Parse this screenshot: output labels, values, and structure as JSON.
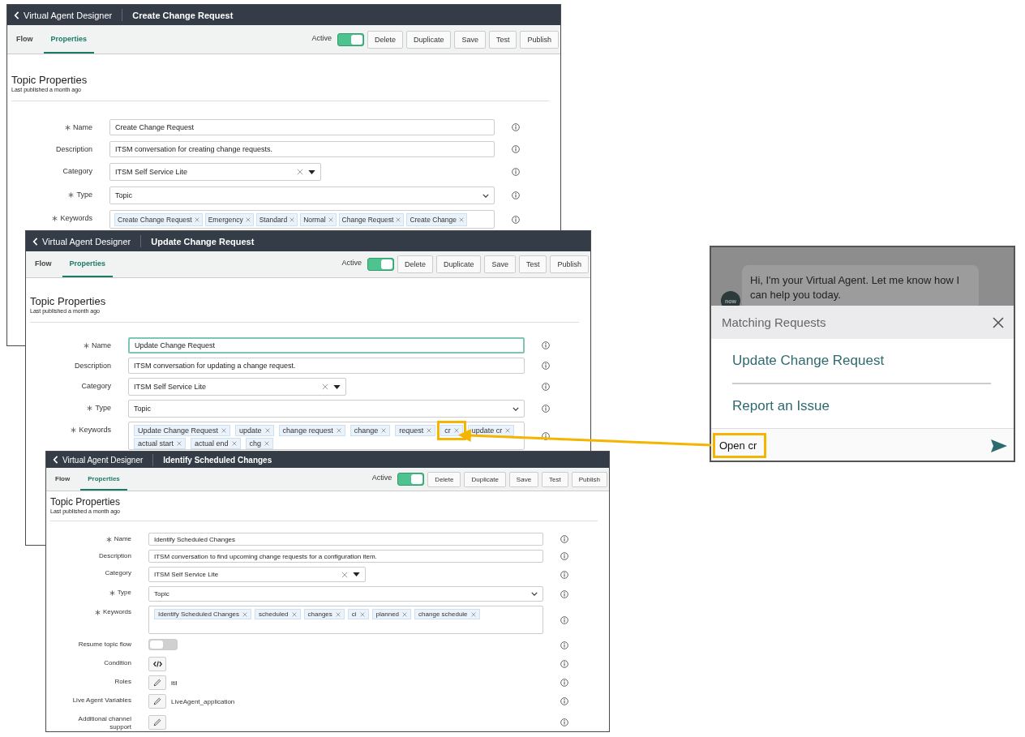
{
  "windows": [
    {
      "breadcrumb": "Virtual Agent Designer",
      "title": "Create Change Request",
      "tabs": [
        {
          "label": "Flow",
          "selected": false
        },
        {
          "label": "Properties",
          "selected": true
        }
      ],
      "active": {
        "label": "Active",
        "on": true
      },
      "buttons": [
        "Delete",
        "Duplicate",
        "Save",
        "Test",
        "Publish"
      ],
      "heading": "Topic Properties",
      "subheading": "Last published a month ago",
      "fields": [
        {
          "kind": "text",
          "label": "Name",
          "required": true,
          "value": "Create Change Request",
          "focused": false
        },
        {
          "kind": "text",
          "label": "Description",
          "required": false,
          "value": "ITSM conversation for creating change requests.",
          "focused": false
        },
        {
          "kind": "select",
          "label": "Category",
          "required": false,
          "value": "ITSM Self Service Lite"
        },
        {
          "kind": "dropdown",
          "label": "Type",
          "required": true,
          "value": "Topic"
        },
        {
          "kind": "keywords",
          "label": "Keywords",
          "required": true,
          "keywords": [
            {
              "text": "Create Change Request",
              "highlighted": false
            },
            {
              "text": "Emergency",
              "highlighted": false
            },
            {
              "text": "Standard",
              "highlighted": false
            },
            {
              "text": "Normal",
              "highlighted": false
            },
            {
              "text": "Change Request",
              "highlighted": false
            },
            {
              "text": "Create Change",
              "highlighted": false
            }
          ]
        }
      ]
    },
    {
      "breadcrumb": "Virtual Agent Designer",
      "title": "Update Change Request",
      "tabs": [
        {
          "label": "Flow",
          "selected": false
        },
        {
          "label": "Properties",
          "selected": true
        }
      ],
      "active": {
        "label": "Active",
        "on": true
      },
      "buttons": [
        "Delete",
        "Duplicate",
        "Save",
        "Test",
        "Publish"
      ],
      "heading": "Topic Properties",
      "subheading": "Last published a month ago",
      "fields": [
        {
          "kind": "text",
          "label": "Name",
          "required": true,
          "value": "Update Change Request",
          "focused": true
        },
        {
          "kind": "text",
          "label": "Description",
          "required": false,
          "value": "ITSM conversation for updating a change request.",
          "focused": false
        },
        {
          "kind": "select",
          "label": "Category",
          "required": false,
          "value": "ITSM Self Service Lite"
        },
        {
          "kind": "dropdown",
          "label": "Type",
          "required": true,
          "value": "Topic"
        },
        {
          "kind": "keywords",
          "label": "Keywords",
          "required": true,
          "keywords": [
            {
              "text": "Update Change Request",
              "highlighted": false
            },
            {
              "text": "update",
              "highlighted": false
            },
            {
              "text": "change request",
              "highlighted": false
            },
            {
              "text": "change",
              "highlighted": false
            },
            {
              "text": "request",
              "highlighted": false
            },
            {
              "text": "cr",
              "highlighted": true
            },
            {
              "text": "update cr",
              "highlighted": false
            },
            {
              "text": "actual start",
              "highlighted": false
            },
            {
              "text": "actual end",
              "highlighted": false
            },
            {
              "text": "chg",
              "highlighted": false
            }
          ]
        }
      ]
    },
    {
      "breadcrumb": "Virtual Agent Designer",
      "title": "Identify Scheduled Changes",
      "tabs": [
        {
          "label": "Flow",
          "selected": false
        },
        {
          "label": "Properties",
          "selected": true
        }
      ],
      "active": {
        "label": "Active",
        "on": true
      },
      "buttons": [
        "Delete",
        "Duplicate",
        "Save",
        "Test",
        "Publish"
      ],
      "heading": "Topic Properties",
      "subheading": "Last published a month ago",
      "fields": [
        {
          "kind": "text",
          "label": "Name",
          "required": true,
          "value": "Identify Scheduled Changes",
          "focused": false
        },
        {
          "kind": "text",
          "label": "Description",
          "required": false,
          "value": "ITSM conversation to find upcoming change requests for a configuration item.",
          "focused": false
        },
        {
          "kind": "select",
          "label": "Category",
          "required": false,
          "value": "ITSM Self Service Lite"
        },
        {
          "kind": "dropdown",
          "label": "Type",
          "required": true,
          "value": "Topic"
        },
        {
          "kind": "keywords",
          "label": "Keywords",
          "required": true,
          "keywords": [
            {
              "text": "Identify Scheduled Changes",
              "highlighted": false
            },
            {
              "text": "scheduled",
              "highlighted": false
            },
            {
              "text": "changes",
              "highlighted": false
            },
            {
              "text": "ci",
              "highlighted": false
            },
            {
              "text": "planned",
              "highlighted": false
            },
            {
              "text": "change schedule",
              "highlighted": false
            }
          ]
        },
        {
          "kind": "toggle",
          "label": "Resume topic flow",
          "required": false,
          "on": false
        },
        {
          "kind": "code",
          "label": "Condition",
          "required": false
        },
        {
          "kind": "edit",
          "label": "Roles",
          "required": false,
          "value": "itil"
        },
        {
          "kind": "edit",
          "label": "Live Agent Variables",
          "required": false,
          "value": "LiveAgent_application"
        },
        {
          "kind": "edit",
          "label": "Additional channel support",
          "required": false
        }
      ]
    }
  ],
  "chat": {
    "avatar_text": "now",
    "greeting": "Hi, I'm your Virtual Agent. Let me know how I can help you today.",
    "panel_title": "Matching Requests",
    "items": [
      "Update Change Request",
      "Report an Issue"
    ],
    "input": {
      "value": "Open cr",
      "highlighted": true
    }
  }
}
